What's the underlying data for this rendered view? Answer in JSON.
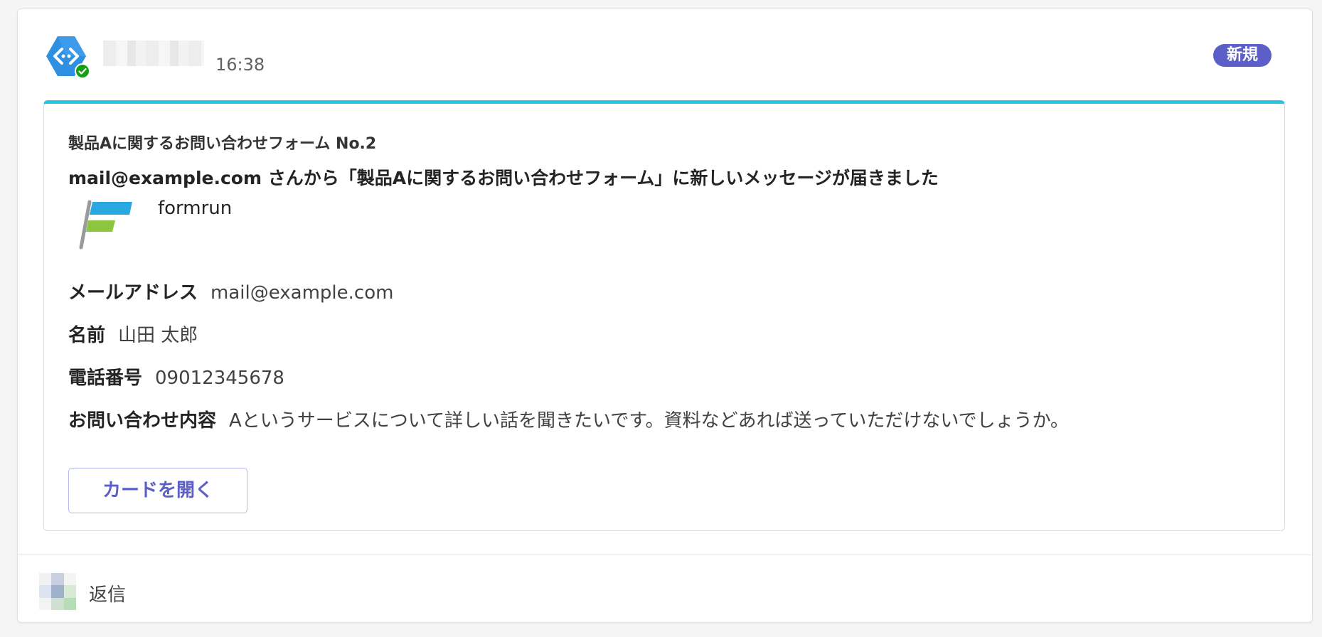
{
  "message": {
    "time": "16:38",
    "badge": "新規"
  },
  "card": {
    "title": "製品Aに関するお問い合わせフォーム No.2",
    "subtitle": "mail@example.com さんから「製品Aに関するお問い合わせフォーム」に新しいメッセージが届きました",
    "app_name": "formrun",
    "fields": [
      {
        "label": "メールアドレス",
        "value": "mail@example.com"
      },
      {
        "label": "名前",
        "value": "山田 太郎"
      },
      {
        "label": "電話番号",
        "value": "09012345678"
      },
      {
        "label": "お問い合わせ内容",
        "value": "Aというサービスについて詳しい話を聞きたいです。資料などあれば送っていただけないでしょうか。"
      }
    ],
    "open_button_label": "カードを開く"
  },
  "reply": {
    "label": "返信"
  },
  "icons": {
    "bot_avatar": "bot-avatar-icon",
    "presence": "presence-available-icon",
    "formrun_logo": "formrun-logo-icon"
  },
  "colors": {
    "accent": "#5b5fc7",
    "card_top_border": "#26c6e6",
    "presence_green": "#13a10e",
    "avatar_blue": "#2f8fe0"
  }
}
